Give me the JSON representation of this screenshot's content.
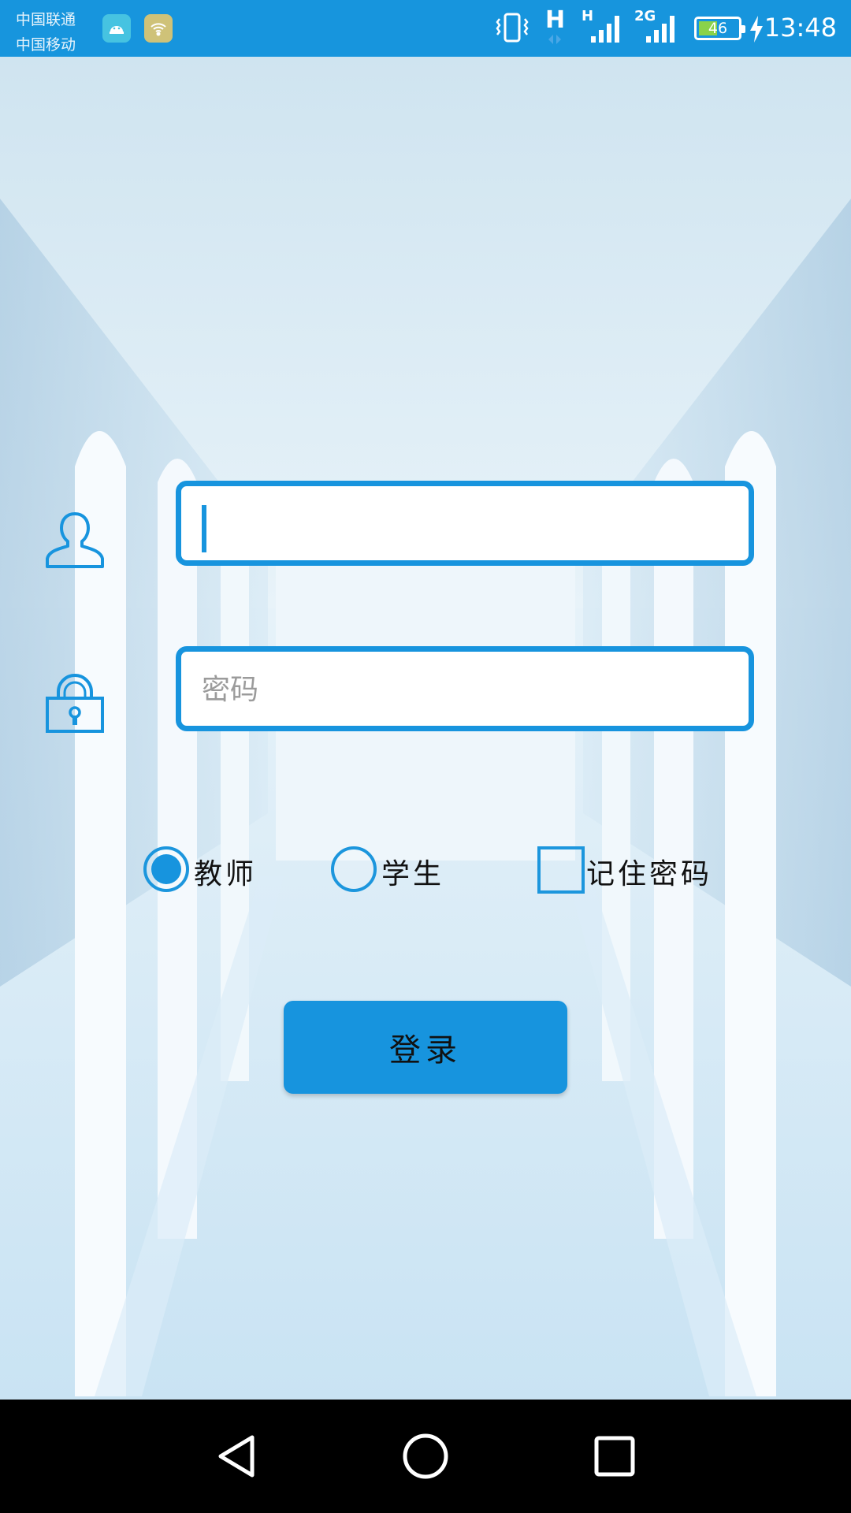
{
  "status_bar": {
    "carrier_1": "中国联通",
    "carrier_2": "中国移动",
    "network_1": "H",
    "network_2": "H",
    "network_3": "2G",
    "battery_level": "46",
    "time": "13:48"
  },
  "login": {
    "username_value": "",
    "password_placeholder": "密码",
    "role_options": [
      "教师",
      "学生"
    ],
    "selected_role": "教师",
    "remember_label": "记住密码",
    "remember_checked": false,
    "login_label": "登录"
  },
  "colors": {
    "accent": "#1794de",
    "status_bar": "#1795dd",
    "nav_bar": "#000000"
  },
  "icons": [
    "user-icon",
    "lock-icon",
    "back-icon",
    "home-icon",
    "recent-apps-icon"
  ]
}
